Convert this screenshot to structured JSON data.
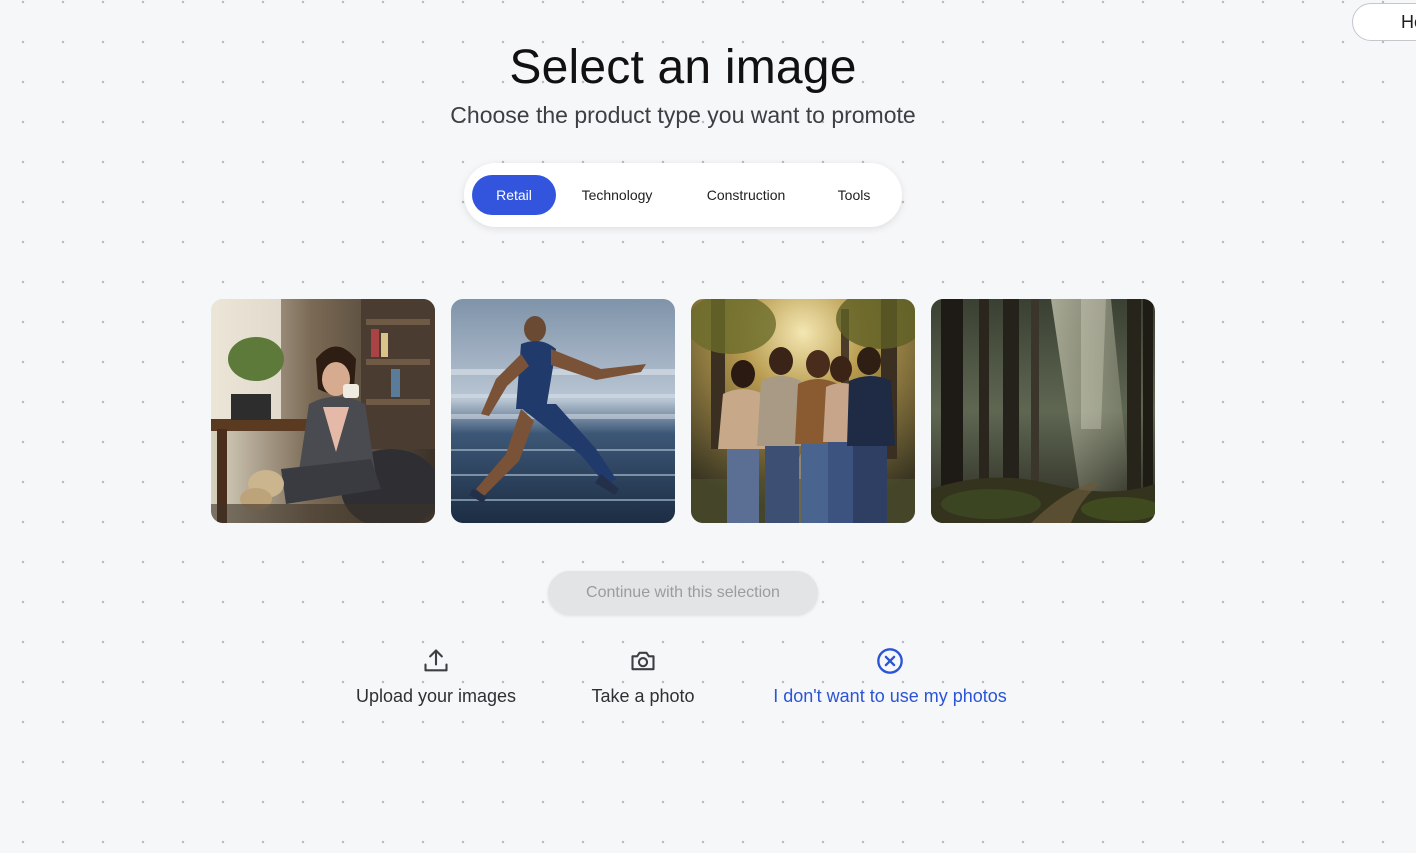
{
  "header": {
    "corner_button_label": "He",
    "title": "Select an image",
    "subtitle": "Choose the product type you want to promote"
  },
  "tabs": [
    {
      "label": "Retail",
      "active": true
    },
    {
      "label": "Technology",
      "active": false
    },
    {
      "label": "Construction",
      "active": false
    },
    {
      "label": "Tools",
      "active": false
    }
  ],
  "gallery": {
    "images": [
      {
        "subject": "woman-with-mug-home-office"
      },
      {
        "subject": "sprinter-running-on-track"
      },
      {
        "subject": "group-of-friends-laughing-in-park"
      },
      {
        "subject": "sunlit-misty-forest"
      }
    ]
  },
  "actions": {
    "continue_label": "Continue with this selection",
    "upload_label": "Upload your images",
    "photo_label": "Take a photo",
    "no_photos_label": "I don't want to use my photos"
  },
  "colors": {
    "accent": "#3355dd",
    "link": "#2b54d6",
    "background": "#f6f7f9",
    "disabled_bg": "#e3e4e6",
    "disabled_text": "#9a9ca0"
  },
  "icons": {
    "upload": "upload-icon",
    "camera": "camera-icon",
    "cancel": "cancel-circle-icon"
  }
}
